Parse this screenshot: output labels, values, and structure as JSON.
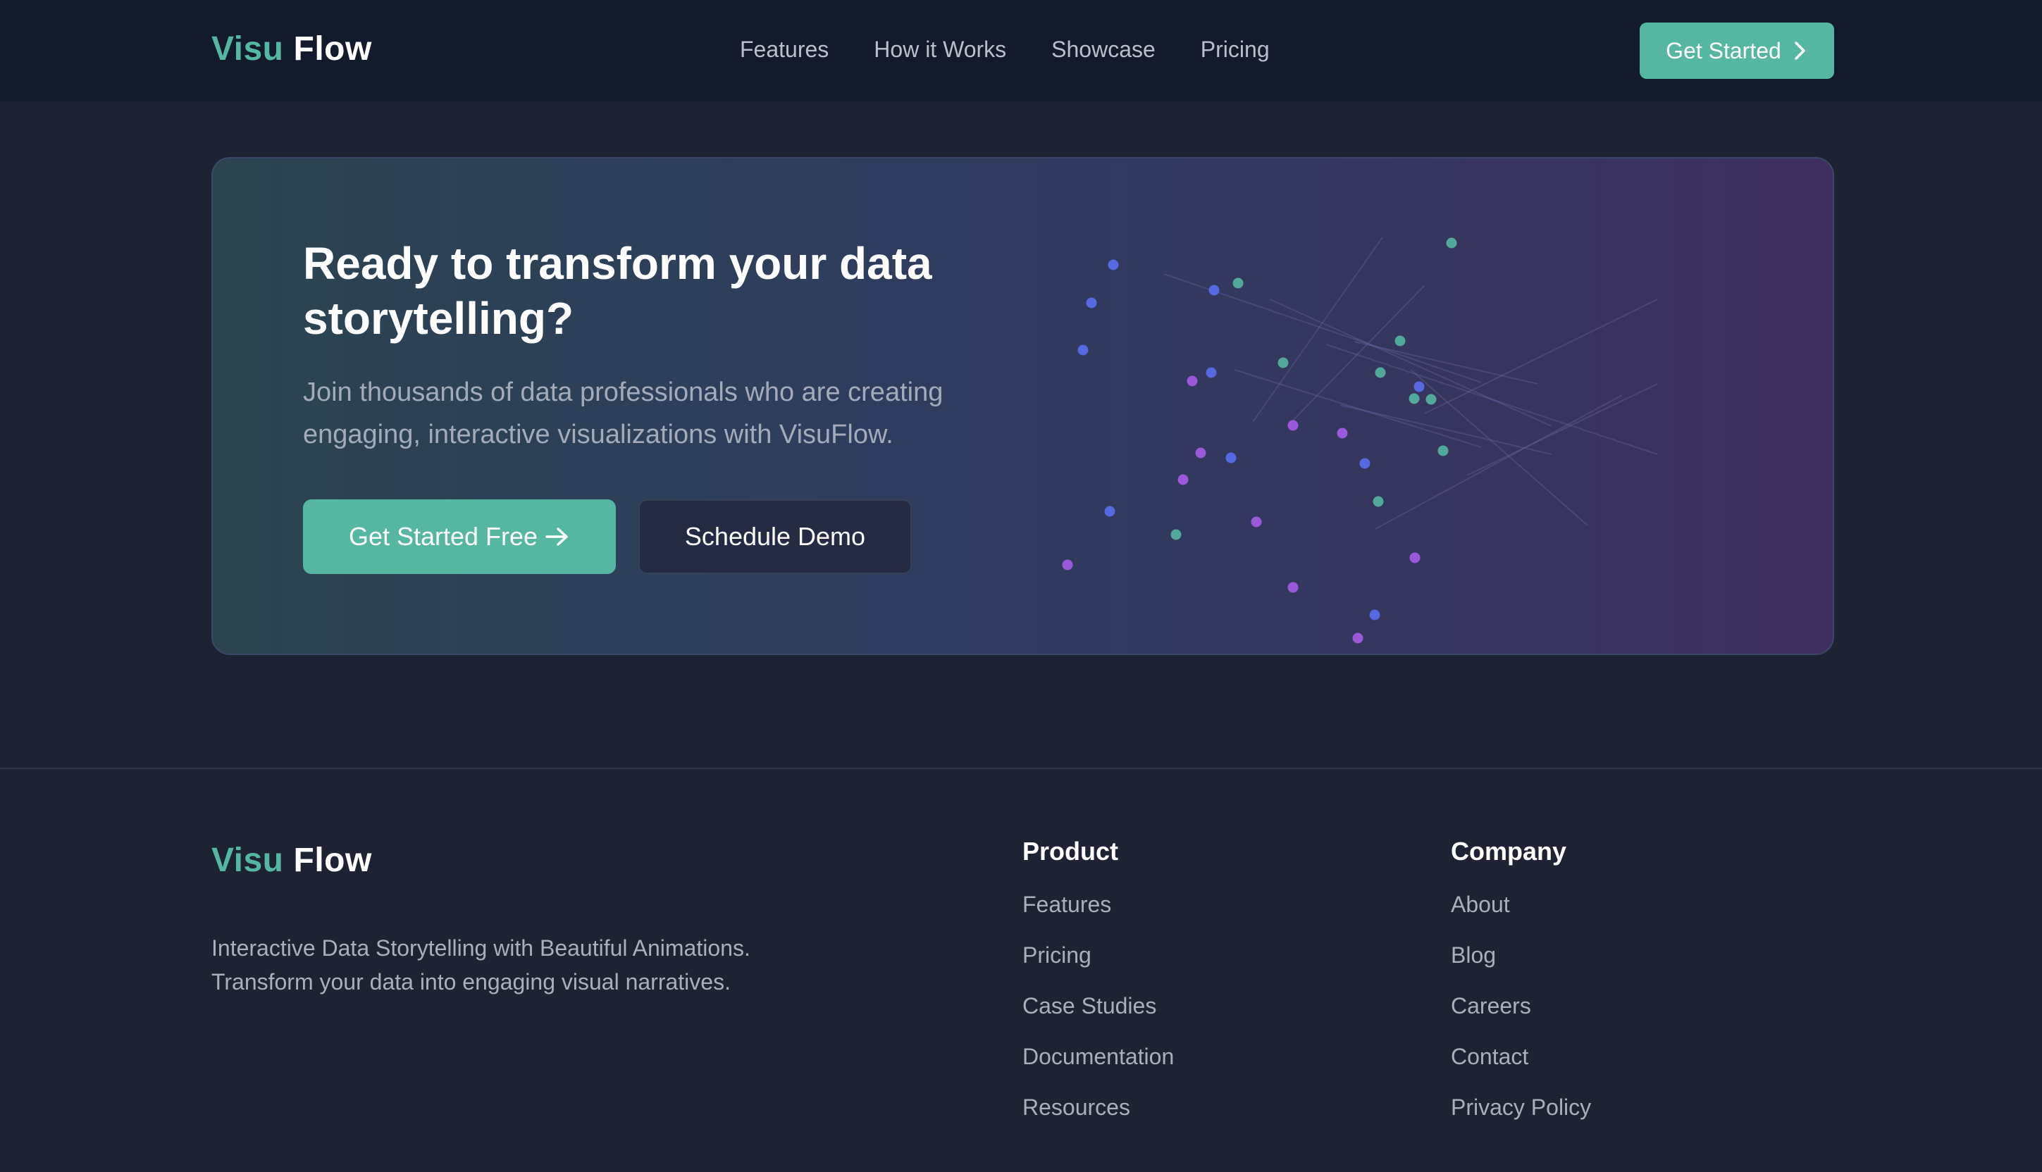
{
  "brand": {
    "logo_part1": "Visu",
    "logo_part2": "Flow",
    "accent_color": "#55b6a2"
  },
  "nav": {
    "links": [
      {
        "label": "Features"
      },
      {
        "label": "How it Works"
      },
      {
        "label": "Showcase"
      },
      {
        "label": "Pricing"
      }
    ],
    "cta_label": "Get Started",
    "cta_icon": "chevron-right-icon"
  },
  "cta": {
    "title": "Ready to transform your data storytelling?",
    "subtitle": "Join thousands of data professionals who are creating engaging, interactive visualizations with VisuFlow.",
    "primary_label": "Get Started Free",
    "primary_icon": "arrow-right-icon",
    "secondary_label": "Schedule Demo",
    "visual": "animated-network-dots",
    "dot_colors": [
      "#55b6a2",
      "#5b6ff0",
      "#a55de8"
    ]
  },
  "footer": {
    "description": "Interactive Data Storytelling with Beautiful Animations. Transform your data into engaging visual narratives.",
    "columns": [
      {
        "heading": "Product",
        "links": [
          "Features",
          "Pricing",
          "Case Studies",
          "Documentation",
          "Resources"
        ]
      },
      {
        "heading": "Company",
        "links": [
          "About",
          "Blog",
          "Careers",
          "Contact",
          "Privacy Policy"
        ]
      }
    ]
  }
}
